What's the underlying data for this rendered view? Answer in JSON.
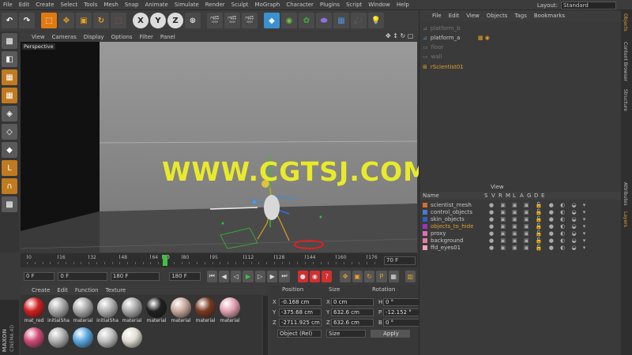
{
  "menu": {
    "items": [
      "File",
      "Edit",
      "Create",
      "Select",
      "Tools",
      "Mesh",
      "Snap",
      "Animate",
      "Simulate",
      "Render",
      "Sculpt",
      "MoGraph",
      "Character",
      "Plugins",
      "Script",
      "Window",
      "Help"
    ],
    "layout_label": "Layout:",
    "layout_value": "Standard"
  },
  "toolbar": {
    "x_label": "X",
    "y_label": "Y",
    "z_label": "Z"
  },
  "viewport": {
    "menu": [
      "View",
      "Cameras",
      "Display",
      "Options",
      "Filter",
      "Panel"
    ],
    "camera_label": "Perspective",
    "watermark": "WWW.CGTSJ.COM"
  },
  "timeline": {
    "ticks": [
      "0",
      "16",
      "32",
      "48",
      "64",
      "70",
      "80",
      "95",
      "112",
      "128",
      "144",
      "160",
      "176"
    ],
    "current_frame": "70 F"
  },
  "transport": {
    "start_frame": "0 F",
    "min_frame": "0 F",
    "max_frame": "180 F",
    "end_frame": "180 F"
  },
  "materials": {
    "menu": [
      "Create",
      "Edit",
      "Function",
      "Texture"
    ],
    "row1": [
      {
        "label": "mat_red",
        "color": "#d02020"
      },
      {
        "label": "initialSha",
        "color": "#a8a8a8"
      },
      {
        "label": "material",
        "color": "#a8a8a8"
      },
      {
        "label": "initialSha",
        "color": "#b0b0b0"
      },
      {
        "label": "material",
        "color": "#a8a8a8"
      },
      {
        "label": "material",
        "color": "#202020"
      },
      {
        "label": "material",
        "color": "#c8a89a"
      },
      {
        "label": "material",
        "color": "#7a3a22"
      },
      {
        "label": "material",
        "color": "#e2a0b0"
      }
    ],
    "row2": [
      {
        "label": "",
        "color": "#d04a78"
      },
      {
        "label": "",
        "color": "#b0b0b0"
      },
      {
        "label": "",
        "color": "#5aa6e0"
      },
      {
        "label": "",
        "color": "#c0c0c0"
      },
      {
        "label": "",
        "color": "#e0dcd0"
      }
    ],
    "brand_top": "MAXON",
    "brand_bottom": "CINEMA 4D"
  },
  "coordinates": {
    "headers": {
      "position": "Position",
      "size": "Size",
      "rotation": "Rotation"
    },
    "rows": [
      {
        "axis": "X",
        "pos": "-0.168 cm",
        "size": "0 cm",
        "rot_axis": "H",
        "rot": "0 °"
      },
      {
        "axis": "Y",
        "pos": "-375.68 cm",
        "size": "632.6 cm",
        "rot_axis": "P",
        "rot": "-12.152 °"
      },
      {
        "axis": "Z",
        "pos": "-2711.925 cm",
        "size": "632.6 cm",
        "rot_axis": "B",
        "rot": "0 °"
      }
    ],
    "mode": "Object (Rel)",
    "size_mode": "Size",
    "apply": "Apply"
  },
  "objects": {
    "menu": [
      "File",
      "Edit",
      "View",
      "Objects",
      "Tags",
      "Bookmarks"
    ],
    "items": [
      {
        "name": "platform_b",
        "dim": true
      },
      {
        "name": "platform_a",
        "dim": false
      },
      {
        "name": "floor",
        "dim": true
      },
      {
        "name": "wall",
        "dim": true
      },
      {
        "name": "rScientist01",
        "dim": false,
        "color": "#e0a030"
      }
    ]
  },
  "layers": {
    "menu_right": "View",
    "header": [
      "Name",
      "S",
      "V",
      "R",
      "M",
      "L",
      "A",
      "G",
      "D",
      "E"
    ],
    "items": [
      {
        "name": "scientist_mesh",
        "color": "#d07030"
      },
      {
        "name": "control_objects",
        "color": "#4a7ad0"
      },
      {
        "name": "skin_objects",
        "color": "#3060c0"
      },
      {
        "name": "objects_to_hide",
        "color": "#a030c0",
        "highlight": true
      },
      {
        "name": "proxy",
        "color": "#e070b0"
      },
      {
        "name": "background",
        "color": "#e080a0"
      },
      {
        "name": "ffd_eyes01",
        "color": "#f0a0c0"
      }
    ]
  },
  "side_tabs": [
    "Objects",
    "Content Browser",
    "Structure",
    "Attributes",
    "Layers"
  ]
}
